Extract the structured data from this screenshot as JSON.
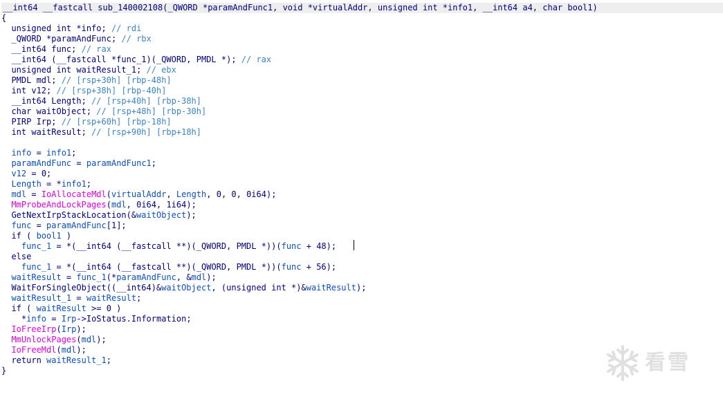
{
  "window": {
    "header": "__int64 __fastcall sub_140002108(_QWORD *paramAndFunc1, void *virtualAddr, unsigned int *info1, __int64 a4, char bool1)"
  },
  "code": {
    "lines": [
      [
        {
          "t": "{",
          "k": "code"
        }
      ],
      [
        {
          "t": "  unsigned int *info; ",
          "k": "code"
        },
        {
          "t": "// rdi",
          "k": "cm"
        }
      ],
      [
        {
          "t": "  _QWORD *paramAndFunc; ",
          "k": "code"
        },
        {
          "t": "// rbx",
          "k": "cm"
        }
      ],
      [
        {
          "t": "  __int64 func; ",
          "k": "code"
        },
        {
          "t": "// rax",
          "k": "cm"
        }
      ],
      [
        {
          "t": "  __int64 (__fastcall *func_1)(_QWORD, PMDL *); ",
          "k": "code"
        },
        {
          "t": "// rax",
          "k": "cm"
        }
      ],
      [
        {
          "t": "  unsigned int waitResult_1; ",
          "k": "code"
        },
        {
          "t": "// ebx",
          "k": "cm"
        }
      ],
      [
        {
          "t": "  PMDL mdl; ",
          "k": "code"
        },
        {
          "t": "// [rsp+30h] [rbp-48h]",
          "k": "cm"
        }
      ],
      [
        {
          "t": "  int v12; ",
          "k": "code"
        },
        {
          "t": "// [rsp+38h] [rbp-40h]",
          "k": "cm"
        }
      ],
      [
        {
          "t": "  __int64 Length; ",
          "k": "code"
        },
        {
          "t": "// [rsp+40h] [rbp-38h]",
          "k": "cm"
        }
      ],
      [
        {
          "t": "  char waitObject; ",
          "k": "code"
        },
        {
          "t": "// [rsp+48h] [rbp-30h]",
          "k": "cm"
        }
      ],
      [
        {
          "t": "  PIRP Irp; ",
          "k": "code"
        },
        {
          "t": "// [rsp+60h] [rbp-18h]",
          "k": "cm"
        }
      ],
      [
        {
          "t": "  int waitResult; ",
          "k": "code"
        },
        {
          "t": "// [rsp+90h] [rbp+18h]",
          "k": "cm"
        }
      ],
      [
        {
          "t": "",
          "k": "code"
        }
      ],
      [
        {
          "t": "  ",
          "k": "code"
        },
        {
          "t": "info",
          "k": "var"
        },
        {
          "t": " = ",
          "k": "code"
        },
        {
          "t": "info1",
          "k": "var"
        },
        {
          "t": ";",
          "k": "code"
        }
      ],
      [
        {
          "t": "  ",
          "k": "code"
        },
        {
          "t": "paramAndFunc",
          "k": "var"
        },
        {
          "t": " = ",
          "k": "code"
        },
        {
          "t": "paramAndFunc1",
          "k": "var"
        },
        {
          "t": ";",
          "k": "code"
        }
      ],
      [
        {
          "t": "  ",
          "k": "code"
        },
        {
          "t": "v12",
          "k": "var"
        },
        {
          "t": " = 0;",
          "k": "code"
        }
      ],
      [
        {
          "t": "  ",
          "k": "code"
        },
        {
          "t": "Length",
          "k": "var"
        },
        {
          "t": " = *",
          "k": "code"
        },
        {
          "t": "info1",
          "k": "var"
        },
        {
          "t": ";",
          "k": "code"
        }
      ],
      [
        {
          "t": "  ",
          "k": "code"
        },
        {
          "t": "mdl",
          "k": "var"
        },
        {
          "t": " = ",
          "k": "code"
        },
        {
          "t": "IoAllocateMdl",
          "k": "func"
        },
        {
          "t": "(",
          "k": "code"
        },
        {
          "t": "virtualAddr",
          "k": "var"
        },
        {
          "t": ", ",
          "k": "code"
        },
        {
          "t": "Length",
          "k": "var"
        },
        {
          "t": ", 0, 0, 0i64);",
          "k": "code"
        }
      ],
      [
        {
          "t": "  ",
          "k": "code"
        },
        {
          "t": "MmProbeAndLockPages",
          "k": "func"
        },
        {
          "t": "(",
          "k": "code"
        },
        {
          "t": "mdl",
          "k": "var"
        },
        {
          "t": ", 0i64, 1i64);",
          "k": "code"
        }
      ],
      [
        {
          "t": "  GetNextIrpStackLocation(&",
          "k": "code"
        },
        {
          "t": "waitObject",
          "k": "var"
        },
        {
          "t": ");",
          "k": "code"
        }
      ],
      [
        {
          "t": "  ",
          "k": "code"
        },
        {
          "t": "func",
          "k": "var"
        },
        {
          "t": " = ",
          "k": "code"
        },
        {
          "t": "paramAndFunc",
          "k": "var"
        },
        {
          "t": "[1];",
          "k": "code"
        }
      ],
      [
        {
          "t": "  if ( ",
          "k": "code"
        },
        {
          "t": "bool1",
          "k": "var"
        },
        {
          "t": " )",
          "k": "code"
        }
      ],
      [
        {
          "t": "    ",
          "k": "code"
        },
        {
          "t": "func_1",
          "k": "var"
        },
        {
          "t": " = *(__int64 (__fastcall **)(_QWORD, PMDL *))(",
          "k": "code"
        },
        {
          "t": "func",
          "k": "var"
        },
        {
          "t": " + 48);",
          "k": "code"
        }
      ],
      [
        {
          "t": "  else",
          "k": "code"
        }
      ],
      [
        {
          "t": "    ",
          "k": "code"
        },
        {
          "t": "func_1",
          "k": "var"
        },
        {
          "t": " = *(__int64 (__fastcall **)(_QWORD, PMDL *))(",
          "k": "code"
        },
        {
          "t": "func",
          "k": "var"
        },
        {
          "t": " + 56);",
          "k": "code"
        }
      ],
      [
        {
          "t": "  ",
          "k": "code"
        },
        {
          "t": "waitResult",
          "k": "var"
        },
        {
          "t": " = ",
          "k": "code"
        },
        {
          "t": "func_1",
          "k": "var"
        },
        {
          "t": "(*",
          "k": "code"
        },
        {
          "t": "paramAndFunc",
          "k": "var"
        },
        {
          "t": ", &",
          "k": "code"
        },
        {
          "t": "mdl",
          "k": "var"
        },
        {
          "t": ");",
          "k": "code"
        }
      ],
      [
        {
          "t": "  WaitForSingleObject((__int64)&",
          "k": "code"
        },
        {
          "t": "waitObject",
          "k": "var"
        },
        {
          "t": ", (unsigned int *)&",
          "k": "code"
        },
        {
          "t": "waitResult",
          "k": "var"
        },
        {
          "t": ");",
          "k": "code"
        }
      ],
      [
        {
          "t": "  ",
          "k": "code"
        },
        {
          "t": "waitResult_1",
          "k": "var"
        },
        {
          "t": " = ",
          "k": "code"
        },
        {
          "t": "waitResult",
          "k": "var"
        },
        {
          "t": ";",
          "k": "code"
        }
      ],
      [
        {
          "t": "  if ( ",
          "k": "code"
        },
        {
          "t": "waitResult",
          "k": "var"
        },
        {
          "t": " >= 0 )",
          "k": "code"
        }
      ],
      [
        {
          "t": "    *",
          "k": "code"
        },
        {
          "t": "info",
          "k": "var"
        },
        {
          "t": " = ",
          "k": "code"
        },
        {
          "t": "Irp",
          "k": "var"
        },
        {
          "t": "->IoStatus.Information;",
          "k": "code"
        }
      ],
      [
        {
          "t": "  ",
          "k": "code"
        },
        {
          "t": "IoFreeIrp",
          "k": "func"
        },
        {
          "t": "(",
          "k": "code"
        },
        {
          "t": "Irp",
          "k": "var"
        },
        {
          "t": ");",
          "k": "code"
        }
      ],
      [
        {
          "t": "  ",
          "k": "code"
        },
        {
          "t": "MmUnlockPages",
          "k": "func"
        },
        {
          "t": "(",
          "k": "code"
        },
        {
          "t": "mdl",
          "k": "var"
        },
        {
          "t": ");",
          "k": "code"
        }
      ],
      [
        {
          "t": "  ",
          "k": "code"
        },
        {
          "t": "IoFreeMdl",
          "k": "func"
        },
        {
          "t": "(",
          "k": "code"
        },
        {
          "t": "mdl",
          "k": "var"
        },
        {
          "t": ");",
          "k": "code"
        }
      ],
      [
        {
          "t": "  return ",
          "k": "code"
        },
        {
          "t": "waitResult_1",
          "k": "var"
        },
        {
          "t": ";",
          "k": "code"
        }
      ],
      [
        {
          "t": "}",
          "k": "code"
        }
      ]
    ]
  },
  "watermark": {
    "text": "看雪",
    "icon": "snowflake-icon",
    "color": "#c8c8c8"
  },
  "colors": {
    "code": "#000080",
    "variable": "#0a4fbf",
    "comment": "#3b84c7",
    "import_function": "#e000e0",
    "header_background": "#eeeeee"
  }
}
